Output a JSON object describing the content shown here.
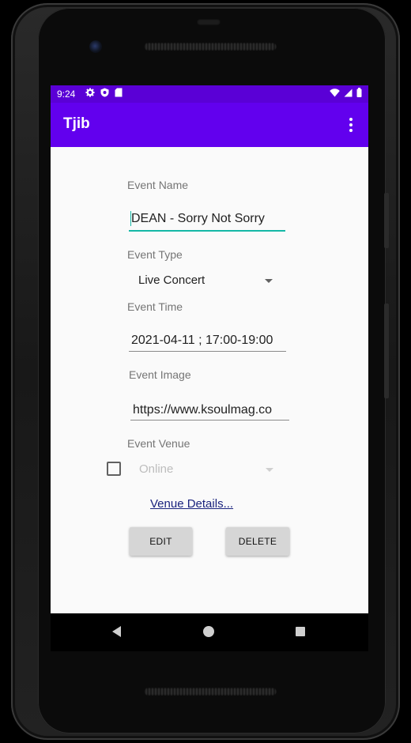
{
  "status_bar": {
    "time": "9:24"
  },
  "app_bar": {
    "title": "Tjib"
  },
  "form": {
    "event_name_label": "Event Name",
    "event_name_value": "DEAN - Sorry Not Sorry",
    "event_type_label": "Event Type",
    "event_type_value": "Live Concert",
    "event_time_label": "Event Time",
    "event_time_value": "2021-04-11 ; 17:00-19:00",
    "event_image_label": "Event Image",
    "event_image_value": "https://www.ksoulmag.co",
    "event_venue_label": "Event Venue",
    "event_venue_value": "Online",
    "venue_checkbox_checked": false,
    "venue_details_link": "Venue Details..."
  },
  "buttons": {
    "edit": "EDIT",
    "delete": "DELETE"
  },
  "colors": {
    "status_bar": "#5a00d6",
    "app_bar": "#6200ee",
    "focus_accent": "#14b8a6",
    "link": "#1a237e"
  },
  "icons": {
    "status_left": [
      "settings-icon",
      "shield-icon",
      "sd-card-icon"
    ],
    "status_right": [
      "wifi-icon",
      "signal-icon",
      "battery-icon"
    ],
    "nav": [
      "back-icon",
      "home-icon",
      "recents-icon"
    ]
  }
}
